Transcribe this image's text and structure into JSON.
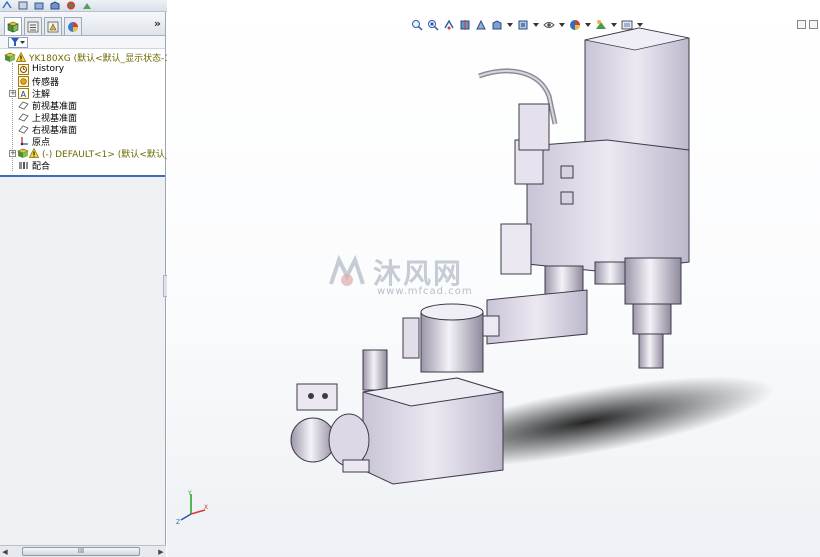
{
  "feature_tree": {
    "root": "YK180XG  (默认<默认_显示状态-1>",
    "items": [
      {
        "label": "History",
        "icon": "history-icon"
      },
      {
        "label": "传感器",
        "icon": "sensor-icon"
      },
      {
        "label": "注解",
        "icon": "annotation-icon"
      },
      {
        "label": "前视基准面",
        "icon": "plane-icon"
      },
      {
        "label": "上视基准面",
        "icon": "plane-icon"
      },
      {
        "label": "右视基准面",
        "icon": "plane-icon"
      },
      {
        "label": "原点",
        "icon": "origin-icon"
      },
      {
        "label": "(-) DEFAULT<1> (默认<默认_显",
        "icon": "part-icon"
      },
      {
        "label": "配合",
        "icon": "mates-icon"
      }
    ],
    "expand_label": "»"
  },
  "scrollbar": {
    "thumb_label": "III"
  },
  "watermark": {
    "brand": "沐风网",
    "url": "www.mfcad.com"
  },
  "colors": {
    "panel_bg": "#eef0f3",
    "accent": "#3d6fb3",
    "model": "#dcd8e6"
  }
}
